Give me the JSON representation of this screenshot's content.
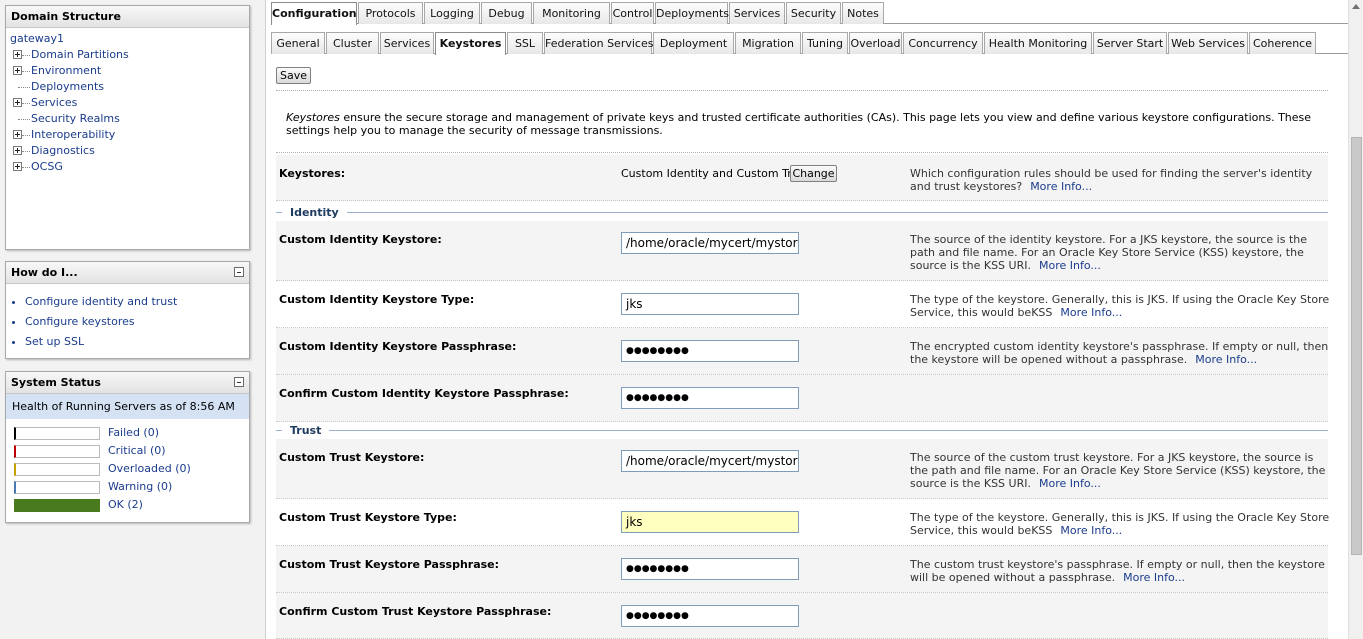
{
  "domain_structure": {
    "title": "Domain Structure",
    "root": "gateway1",
    "items": [
      {
        "label": "Domain Partitions",
        "expandable": true
      },
      {
        "label": "Environment",
        "expandable": true
      },
      {
        "label": "Deployments",
        "expandable": false
      },
      {
        "label": "Services",
        "expandable": true
      },
      {
        "label": "Security Realms",
        "expandable": false
      },
      {
        "label": "Interoperability",
        "expandable": true
      },
      {
        "label": "Diagnostics",
        "expandable": true
      },
      {
        "label": "OCSG",
        "expandable": true
      }
    ]
  },
  "how_do_i": {
    "title": "How do I...",
    "items": [
      "Configure identity and trust",
      "Configure keystores",
      "Set up SSL"
    ]
  },
  "system_status": {
    "title": "System Status",
    "health_text": "Health of Running Servers as of  8:56 AM",
    "rows": [
      {
        "label": "Failed (0)",
        "color": "#000000",
        "fill": 0
      },
      {
        "label": "Critical (0)",
        "color": "#c00000",
        "fill": 0
      },
      {
        "label": "Overloaded (0)",
        "color": "#c8a000",
        "fill": 0
      },
      {
        "label": "Warning (0)",
        "color": "#4a7ab5",
        "fill": 0
      },
      {
        "label": "OK (2)",
        "color": "#4a7a1e",
        "fill": 1
      }
    ]
  },
  "top_tabs": [
    "Configuration",
    "Protocols",
    "Logging",
    "Debug",
    "Monitoring",
    "Control",
    "Deployments",
    "Services",
    "Security",
    "Notes"
  ],
  "top_tabs_active": "Configuration",
  "sub_tabs": [
    "General",
    "Cluster",
    "Services",
    "Keystores",
    "SSL",
    "Federation Services",
    "Deployment",
    "Migration",
    "Tuning",
    "Overload",
    "Concurrency",
    "Health Monitoring",
    "Server Start",
    "Web Services",
    "Coherence"
  ],
  "sub_tabs_active": "Keystores",
  "save_label": "Save",
  "intro": {
    "emph": "Keystores",
    "text": " ensure the secure storage and management of private keys and trusted certificate authorities (CAs). This page lets you view and define various keystore configurations. These settings help you to manage the security of message transmissions."
  },
  "keystores_row": {
    "label": "Keystores:",
    "value": "Custom Identity and Custom Trust",
    "button": "Change",
    "help": "Which configuration rules should be used for finding the server's identity and trust keystores?",
    "more": "More Info..."
  },
  "sections": {
    "identity": "Identity",
    "trust": "Trust"
  },
  "fields": {
    "identity_keystore": {
      "label": "Custom Identity Keystore:",
      "value": "/home/oracle/mycert/mystore.jks",
      "help": "The source of the identity keystore. For a JKS keystore, the source is the path and file name. For an Oracle Key Store Service (KSS) keystore, the source is the KSS URI.",
      "more": "More Info..."
    },
    "identity_keystore_type": {
      "label": "Custom Identity Keystore Type:",
      "value": "jks",
      "help": "The type of the keystore. Generally, this is JKS. If using the Oracle Key Store Service, this would beKSS",
      "more": "More Info..."
    },
    "identity_passphrase": {
      "label": "Custom Identity Keystore Passphrase:",
      "value": "●●●●●●●●",
      "help": "The encrypted custom identity keystore's passphrase. If empty or null, then the keystore will be opened without a passphrase.",
      "more": "More Info..."
    },
    "identity_passphrase_confirm": {
      "label": "Confirm Custom Identity Keystore Passphrase:",
      "value": "●●●●●●●●"
    },
    "trust_keystore": {
      "label": "Custom Trust Keystore:",
      "value": "/home/oracle/mycert/mystore.jks",
      "help": "The source of the custom trust keystore. For a JKS keystore, the source is the path and file name. For an Oracle Key Store Service (KSS) keystore, the source is the KSS URI.",
      "more": "More Info..."
    },
    "trust_keystore_type": {
      "label": "Custom Trust Keystore Type:",
      "value": "jks",
      "help": "The type of the keystore. Generally, this is JKS. If using the Oracle Key Store Service, this would beKSS",
      "more": "More Info..."
    },
    "trust_passphrase": {
      "label": "Custom Trust Keystore Passphrase:",
      "value": "●●●●●●●●",
      "help": "The custom trust keystore's passphrase. If empty or null, then the keystore will be opened without a passphrase.",
      "more": "More Info..."
    },
    "trust_passphrase_confirm": {
      "label": "Confirm Custom Trust Keystore Passphrase:",
      "value": "●●●●●●●●"
    }
  },
  "colors": {
    "link": "#1a3c8c",
    "health_bar_bg": "#d4e2f4",
    "highlight_input": "#ffffc0"
  }
}
